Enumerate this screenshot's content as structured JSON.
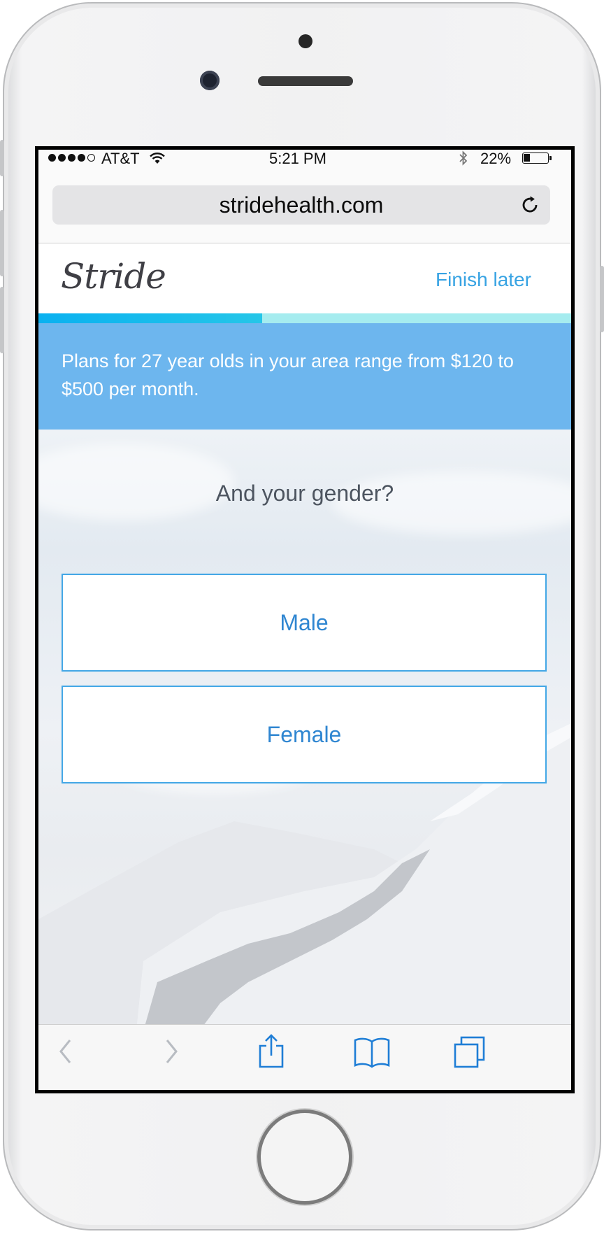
{
  "statusbar": {
    "carrier": "AT&T",
    "time": "5:21 PM",
    "battery_percent": "22%",
    "battery_level": 0.22,
    "signal_bars": 4,
    "icons": [
      "signal-icon",
      "wifi-icon",
      "bluetooth-icon",
      "battery-icon"
    ]
  },
  "browser": {
    "url": "stridehealth.com",
    "icons": {
      "reload": "reload-icon",
      "back": "back-chevron-icon",
      "forward": "forward-chevron-icon",
      "share": "share-icon",
      "bookmarks": "book-icon",
      "tabs": "tabs-icon"
    }
  },
  "header": {
    "logo": "Stride",
    "finish_later": "Finish later"
  },
  "progress": {
    "value": 0.42
  },
  "banner": {
    "text": "Plans for 27 year olds in your area range from $120 to $500 per month."
  },
  "question": {
    "title": "And your gender?",
    "options": [
      "Male",
      "Female"
    ]
  },
  "colors": {
    "accent": "#37a3e3",
    "banner": "#6db6ee",
    "progress_fill": "#0ab1f0",
    "progress_track": "#a5ecef",
    "option_text": "#2f86d1"
  }
}
